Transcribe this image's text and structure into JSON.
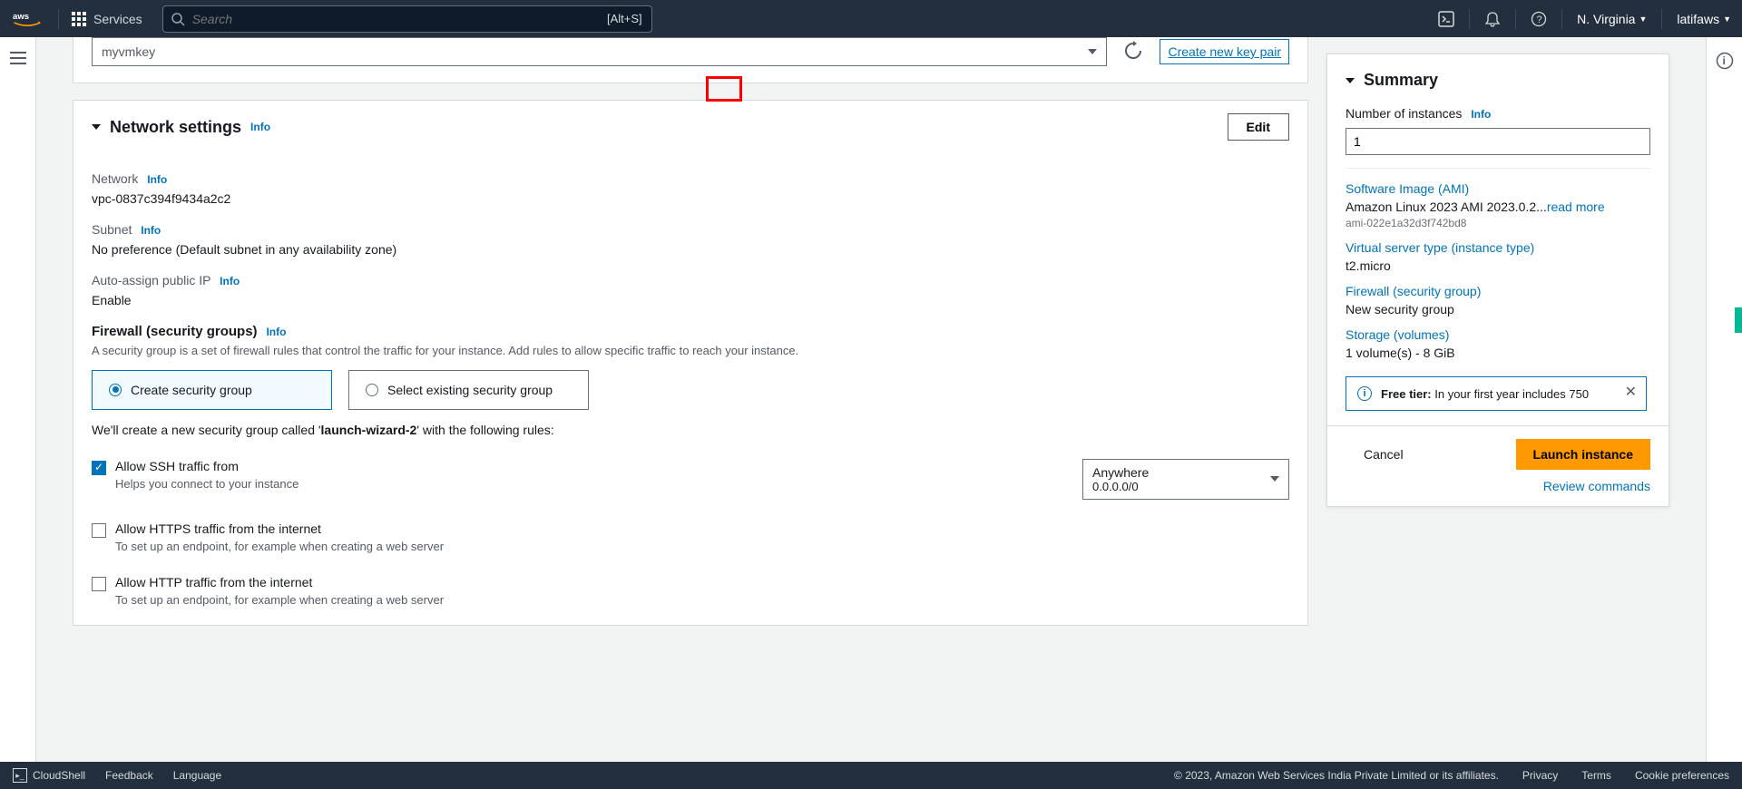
{
  "nav": {
    "services": "Services",
    "search_placeholder": "Search",
    "search_kbd": "[Alt+S]",
    "region": "N. Virginia",
    "user": "latifaws"
  },
  "keypair": {
    "value": "myvmkey",
    "create": "Create new key pair"
  },
  "network": {
    "title": "Network settings",
    "info": "Info",
    "edit": "Edit",
    "network_label": "Network",
    "network_value": "vpc-0837c394f9434a2c2",
    "subnet_label": "Subnet",
    "subnet_value": "No preference (Default subnet in any availability zone)",
    "publicip_label": "Auto-assign public IP",
    "publicip_value": "Enable",
    "fw_title": "Firewall (security groups)",
    "fw_desc": "A security group is a set of firewall rules that control the traffic for your instance. Add rules to allow specific traffic to reach your instance.",
    "create_sg": "Create security group",
    "select_sg": "Select existing security group",
    "sg_prefix": "We'll create a new security group called '",
    "sg_name": "launch-wizard-2",
    "sg_suffix": "' with the following rules:",
    "ssh_label": "Allow SSH traffic from",
    "ssh_help": "Helps you connect to your instance",
    "ssh_source": "Anywhere",
    "ssh_cidr": "0.0.0.0/0",
    "https_label": "Allow HTTPS traffic from the internet",
    "https_help": "To set up an endpoint, for example when creating a web server",
    "http_label": "Allow HTTP traffic from the internet",
    "http_help": "To set up an endpoint, for example when creating a web server"
  },
  "summary": {
    "title": "Summary",
    "num_label": "Number of instances",
    "num_value": "1",
    "ami_label": "Software Image (AMI)",
    "ami_value": "Amazon Linux 2023 AMI 2023.0.2...",
    "read_more": "read more",
    "ami_id": "ami-022e1a32d3f742bd8",
    "type_label": "Virtual server type (instance type)",
    "type_value": "t2.micro",
    "fw_label": "Firewall (security group)",
    "fw_value": "New security group",
    "storage_label": "Storage (volumes)",
    "storage_value": "1 volume(s) - 8 GiB",
    "free_tier_prefix": "Free tier:",
    "free_tier_text": " In your first year includes 750",
    "cancel": "Cancel",
    "launch": "Launch instance",
    "review": "Review commands"
  },
  "footer": {
    "cloudshell": "CloudShell",
    "feedback": "Feedback",
    "language": "Language",
    "copyright": "© 2023, Amazon Web Services India Private Limited or its affiliates.",
    "privacy": "Privacy",
    "terms": "Terms",
    "cookie": "Cookie preferences"
  }
}
